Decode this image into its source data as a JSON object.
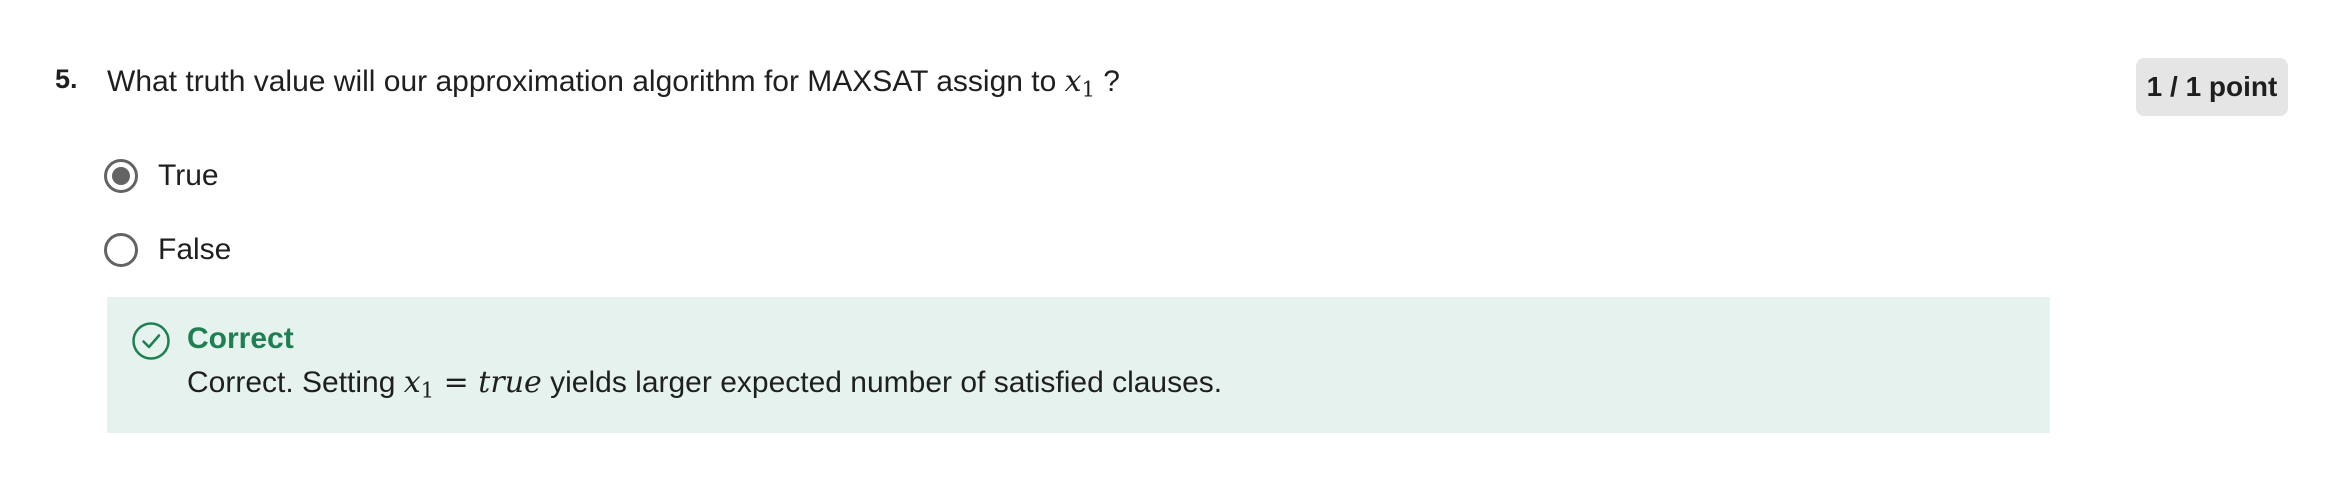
{
  "question": {
    "number": "5.",
    "text_before": "What truth value will our approximation algorithm for MAXSAT assign to",
    "variable": "x",
    "variable_subscript": "1",
    "text_after": "?"
  },
  "score": {
    "label": "1 / 1 point"
  },
  "options": [
    {
      "label": "True",
      "selected": true
    },
    {
      "label": "False",
      "selected": false
    }
  ],
  "feedback": {
    "status": "Correct",
    "text_before": "Correct. Setting",
    "math_var": "x",
    "math_subscript": "1",
    "math_eq": "=",
    "math_value": "true",
    "text_after": "yields larger expected number of satisfied clauses.",
    "icon": "check-circle-icon",
    "accent_color": "#1d7f52",
    "background_color": "#e6f2ee"
  }
}
